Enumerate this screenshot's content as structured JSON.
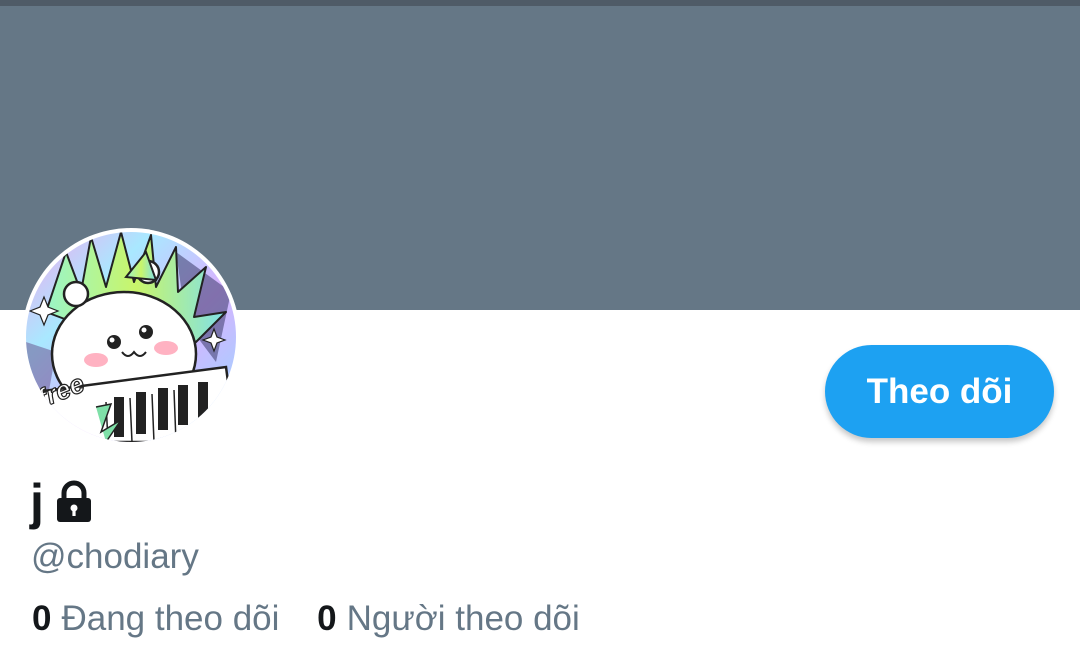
{
  "colors": {
    "banner": "#657786",
    "accent": "#1da1f2",
    "text_primary": "#14171a",
    "text_secondary": "#657786"
  },
  "profile": {
    "display_name": "j",
    "handle": "@chodiary",
    "protected_icon": "lock-icon",
    "avatar_text": "free"
  },
  "actions": {
    "follow_label": "Theo dõi"
  },
  "stats": {
    "following_count": "0",
    "following_label": "Đang theo dõi",
    "followers_count": "0",
    "followers_label": "Người theo dõi"
  }
}
